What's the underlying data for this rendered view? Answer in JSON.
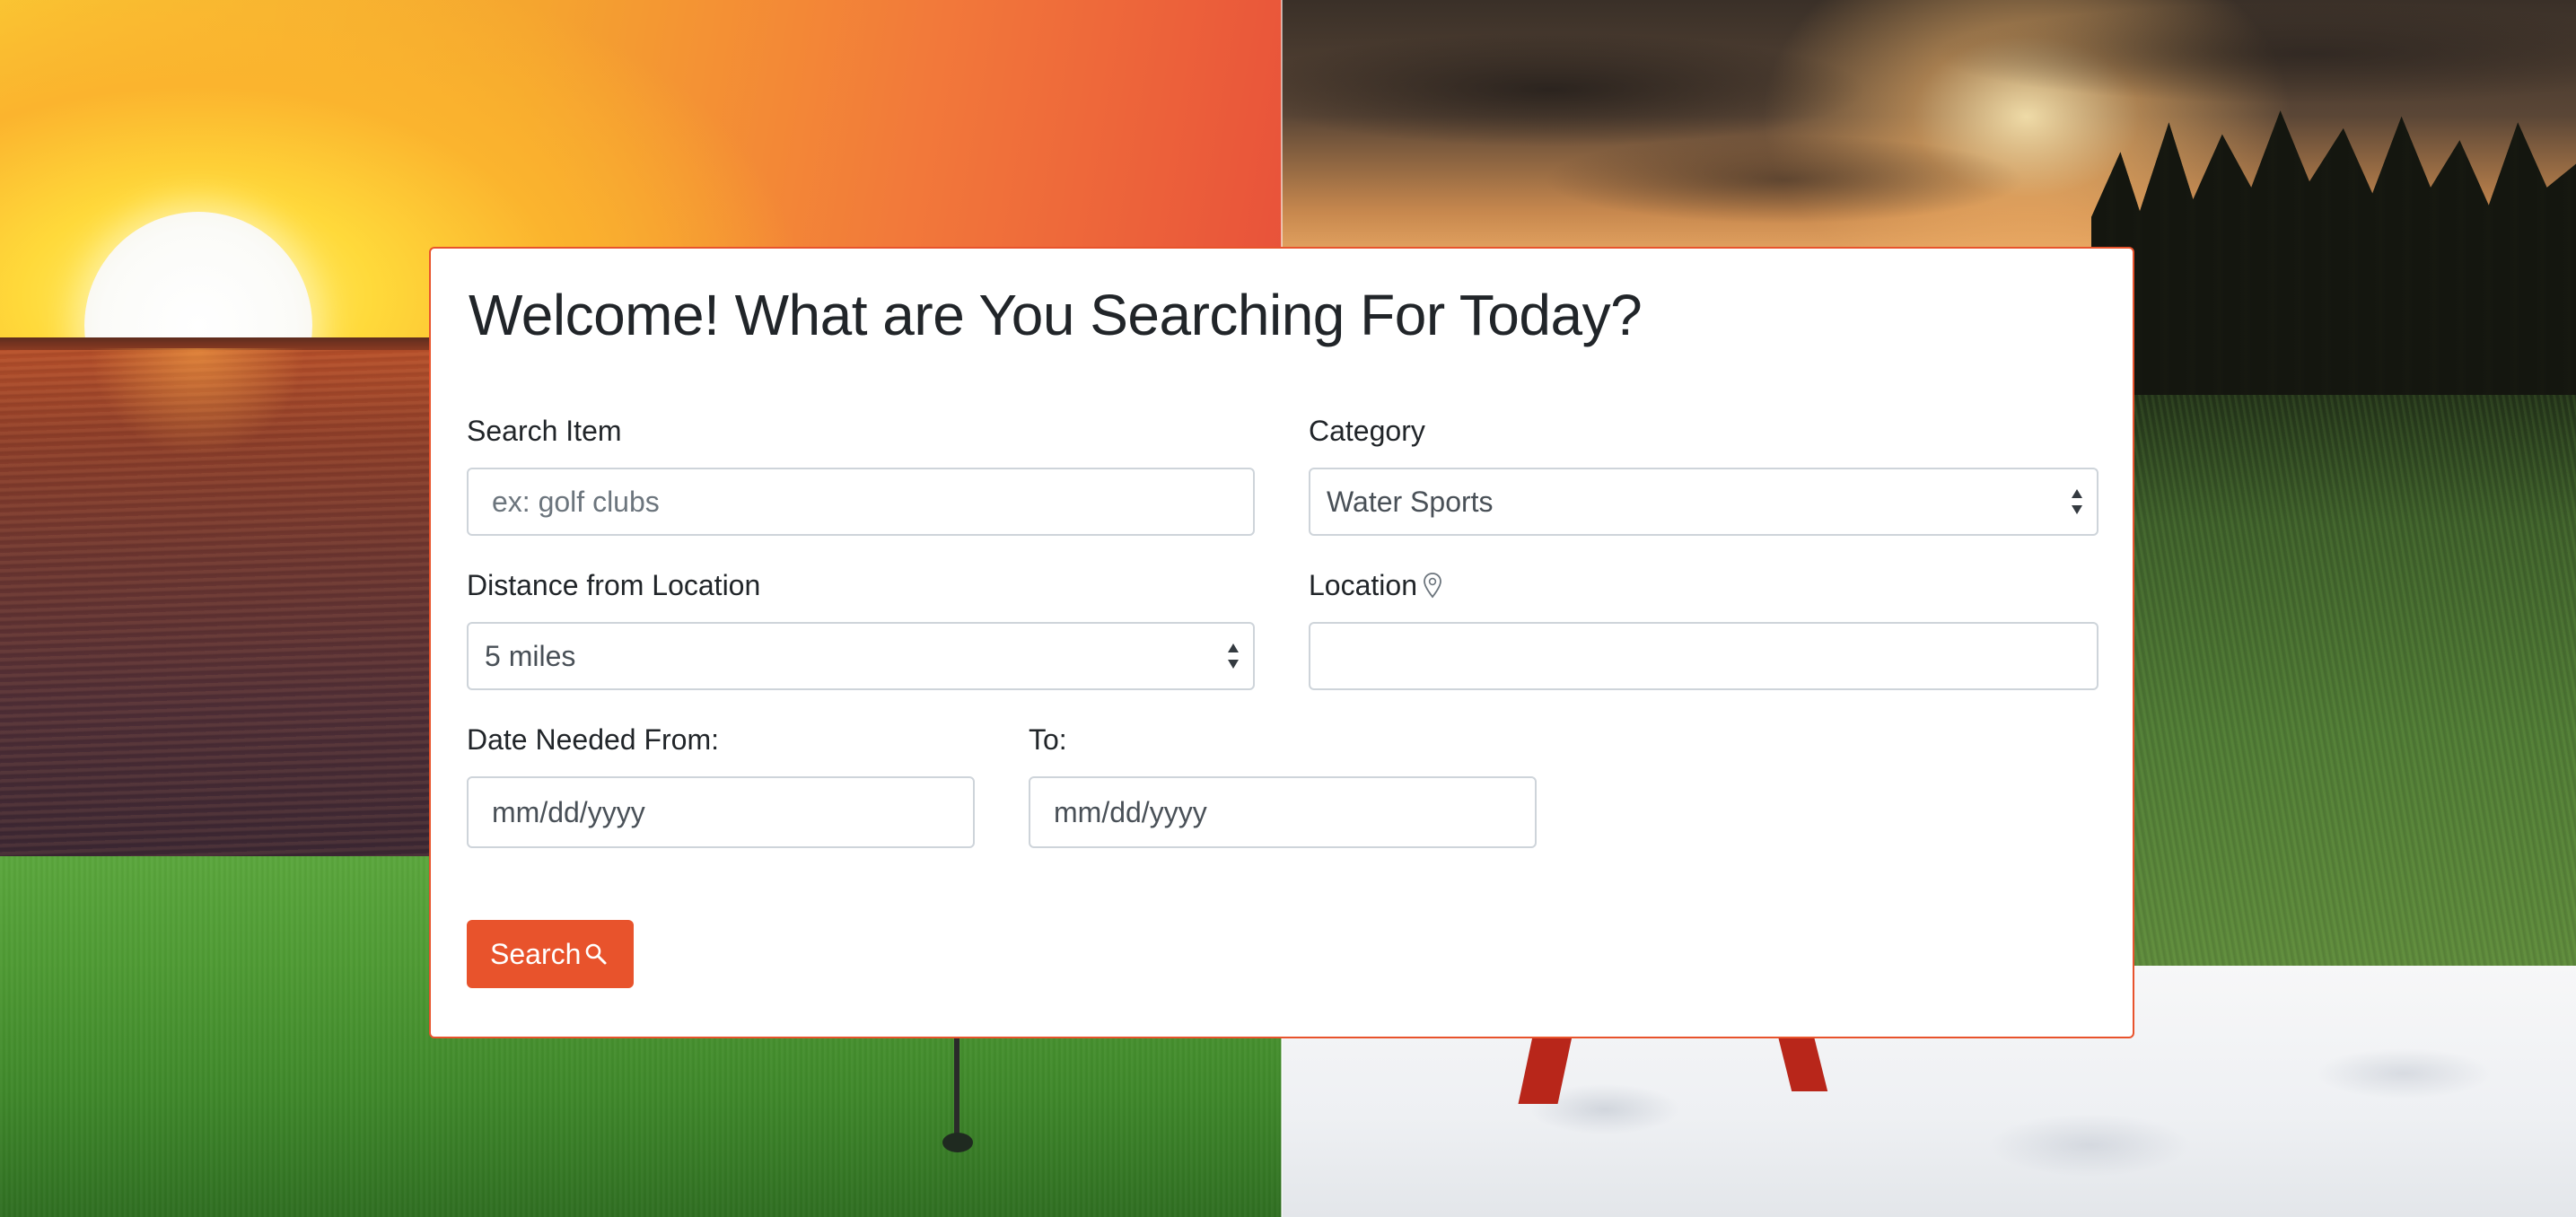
{
  "page": {
    "title": "Welcome! What are You Searching For Today?"
  },
  "form": {
    "search_item": {
      "label": "Search Item",
      "placeholder": "ex: golf clubs",
      "value": ""
    },
    "category": {
      "label": "Category",
      "selected": "Water Sports"
    },
    "distance": {
      "label": "Distance from Location",
      "selected": "5 miles"
    },
    "location": {
      "label": "Location",
      "icon": "map-pin-icon",
      "value": ""
    },
    "date_from": {
      "label": "Date Needed From:",
      "placeholder": "mm/dd/yyyy"
    },
    "date_to": {
      "label": "To:",
      "placeholder": "mm/dd/yyyy"
    },
    "search_button": {
      "label": "Search",
      "icon": "search-icon"
    }
  },
  "theme": {
    "accent": "#e8532c",
    "text": "#212529",
    "input_border": "#ced4da",
    "placeholder": "#6c757d"
  },
  "background": {
    "panels": [
      "sunset-over-sea",
      "golf-green",
      "forest-sunset",
      "snow-skiing"
    ]
  }
}
